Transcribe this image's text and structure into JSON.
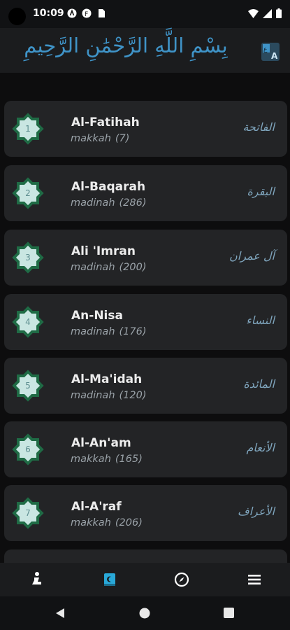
{
  "status_bar": {
    "time": "10:09",
    "icons": [
      "accessibility-icon",
      "app-icon",
      "sim-card-icon",
      "wifi-icon",
      "signal-icon",
      "battery-icon"
    ]
  },
  "header": {
    "bismillah": "بِسْمِ اللَّهِ الرَّحْمَٰنِ الرَّحِيمِ",
    "lang_icon": "translate-icon"
  },
  "surahs": [
    {
      "number": "1",
      "name": "Al-Fatihah",
      "type": "makkah",
      "verses": "(7)",
      "arabic": "الفاتحة"
    },
    {
      "number": "2",
      "name": "Al-Baqarah",
      "type": "madinah",
      "verses": "(286)",
      "arabic": "البقرة"
    },
    {
      "number": "3",
      "name": "Ali 'Imran",
      "type": "madinah",
      "verses": "(200)",
      "arabic": "آل عمران"
    },
    {
      "number": "4",
      "name": "An-Nisa",
      "type": "madinah",
      "verses": "(176)",
      "arabic": "النساء"
    },
    {
      "number": "5",
      "name": "Al-Ma'idah",
      "type": "madinah",
      "verses": "(120)",
      "arabic": "المائدة"
    },
    {
      "number": "6",
      "name": "Al-An'am",
      "type": "makkah",
      "verses": "(165)",
      "arabic": "الأنعام"
    },
    {
      "number": "7",
      "name": "Al-A'raf",
      "type": "makkah",
      "verses": "(206)",
      "arabic": "الأعراف"
    }
  ],
  "bottom_nav": {
    "items": [
      "prayer-icon",
      "quran-icon",
      "compass-icon",
      "menu-icon"
    ],
    "active": "quran-icon"
  },
  "colors": {
    "accent": "#3f93c7",
    "active_tab": "#29a8d8",
    "badge_fill": "#c9e6e2",
    "badge_stroke": "#1f6b45",
    "card_bg": "#232426"
  }
}
